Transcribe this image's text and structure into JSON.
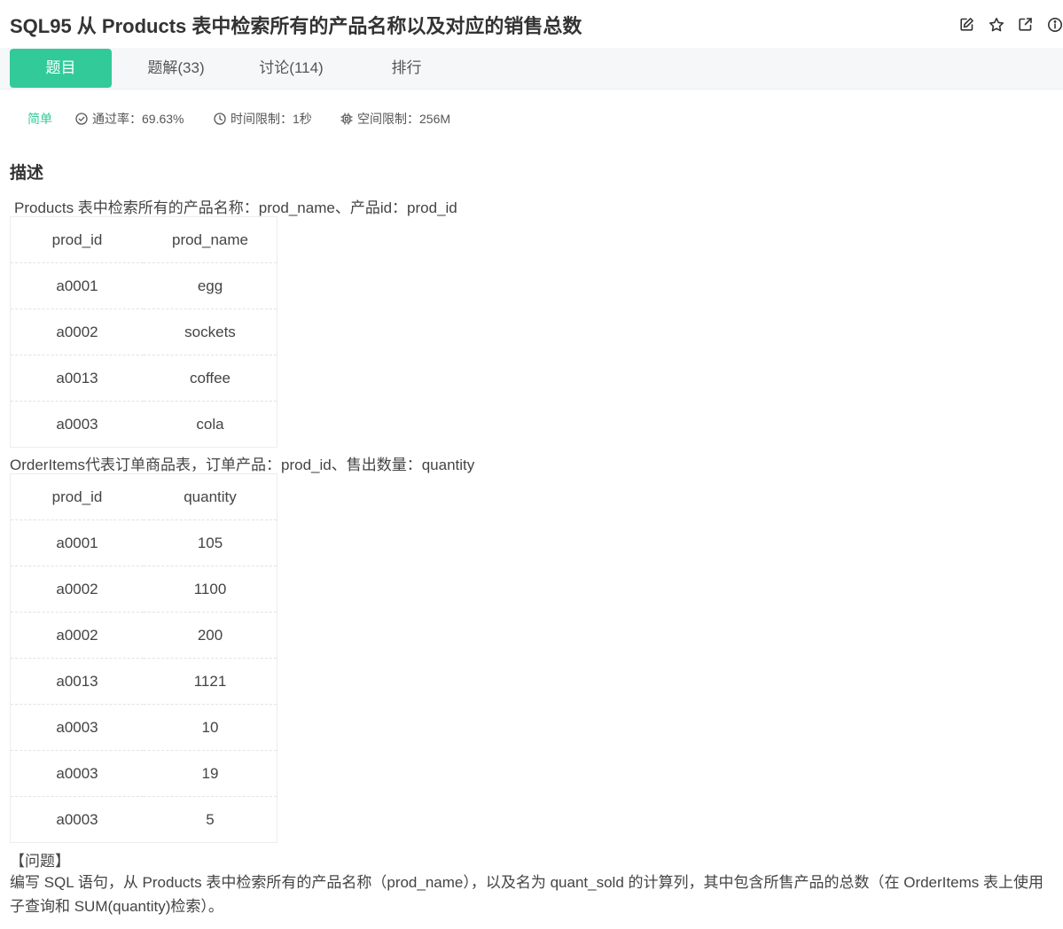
{
  "header": {
    "title": "SQL95  从 Products 表中检索所有的产品名称以及对应的销售总数",
    "icons": [
      "edit-icon",
      "star-icon",
      "external-link-icon",
      "info-icon"
    ]
  },
  "tabs": [
    {
      "label": "题目",
      "active": true
    },
    {
      "label": "题解(33)",
      "active": false
    },
    {
      "label": "讨论(114)",
      "active": false
    },
    {
      "label": "排行",
      "active": false
    }
  ],
  "meta": {
    "difficulty": "简单",
    "pass_rate": "通过率：69.63%",
    "time_limit": "时间限制：1秒",
    "space_limit": "空间限制：256M"
  },
  "description": {
    "heading": "描述",
    "products_intro": "Products 表中检索所有的产品名称：prod_name、产品id：prod_id",
    "products_table": {
      "headers": [
        "prod_id",
        "prod_name"
      ],
      "rows": [
        [
          "a0001",
          "egg"
        ],
        [
          "a0002",
          "sockets"
        ],
        [
          "a0013",
          "coffee"
        ],
        [
          "a0003",
          "cola"
        ]
      ]
    },
    "orderitems_intro": "OrderItems代表订单商品表，订单产品：prod_id、售出数量：quantity",
    "orderitems_table": {
      "headers": [
        "prod_id",
        "quantity"
      ],
      "rows": [
        [
          "a0001",
          "105"
        ],
        [
          "a0002",
          "1100"
        ],
        [
          "a0002",
          "200"
        ],
        [
          "a0013",
          "1121"
        ],
        [
          "a0003",
          "10"
        ],
        [
          "a0003",
          "19"
        ],
        [
          "a0003",
          "5"
        ]
      ]
    },
    "problem_label": "【问题】",
    "problem_text": "编写 SQL 语句，从 Products 表中检索所有的产品名称（prod_name），以及名为 quant_sold 的计算列，其中包含所售产品的总数（在 OrderItems 表上使用子查询和 SUM(quantity)检索）。"
  },
  "colors": {
    "accent": "#32ca99",
    "tab_bar_bg": "#f6f7f9",
    "text": "#333333"
  }
}
